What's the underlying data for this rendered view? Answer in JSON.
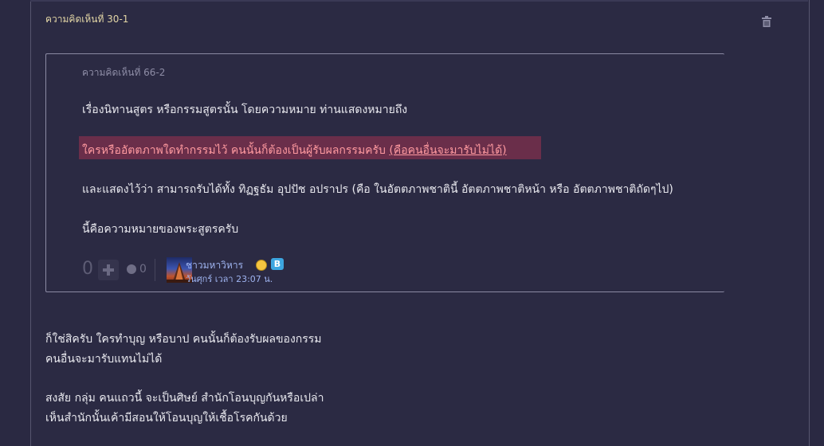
{
  "comment": {
    "title": "ความคิดเห็นที่ 30-1",
    "delete_icon": "trash-icon"
  },
  "quote": {
    "title": "ความคิดเห็นที่ 66-2",
    "line1": "เรื่องนิทานสูตร หรือกรรมสูตรนั้น โดยความหมาย ท่านแสดงหมายถึง",
    "highlight_text": "ใครหรืออัตตภาพใดทำกรรมไว้  คนนั้นก็ต้องเป็นผู้รับผลกรรมครับ ",
    "highlight_underlined": "(คือคนอื่นจะมารับไม่ได้)",
    "line3": "และแสดงไว้ว่า สามารถรับได้ทั้ง ทิฏฐธัม อุปปัช อปราปร (คือ ในอัตตภาพชาตินี้ อัตตภาพชาติหน้า หรือ อัตตภาพชาติถัดๆไป)",
    "line4": "นี้คือความหมายของพระสูตรครับ",
    "footer": {
      "score": "0",
      "emotion_count": "0",
      "author": "ชาวมหาวิหาร",
      "author_badge": "B",
      "date": "วันศุกร์ เวลา 23:07 น."
    }
  },
  "body": {
    "line1": "ก็ใช่สิครับ ใครทำบุญ หรือบาป คนนั้นก็ต้องรับผลของกรรม",
    "line2": "คนอื่นจะมารับแทนไม่ได้",
    "line3": "สงสัย กลุ่ม คนแถวนี้ จะเป็นศิษย์ สำนักโอนบุญกันหรือเปล่า",
    "line4": "เห็นสำนักนั้นเค้ามีสอนให้โอนบุญให้เชื้อโรคกันด้วย"
  },
  "colors": {
    "background": "#2b2a43",
    "title": "#e3d6a6",
    "highlight_bg": "#6a2e4a",
    "highlight_text": "#ff9aa0",
    "author_link": "#9fb4f0"
  }
}
